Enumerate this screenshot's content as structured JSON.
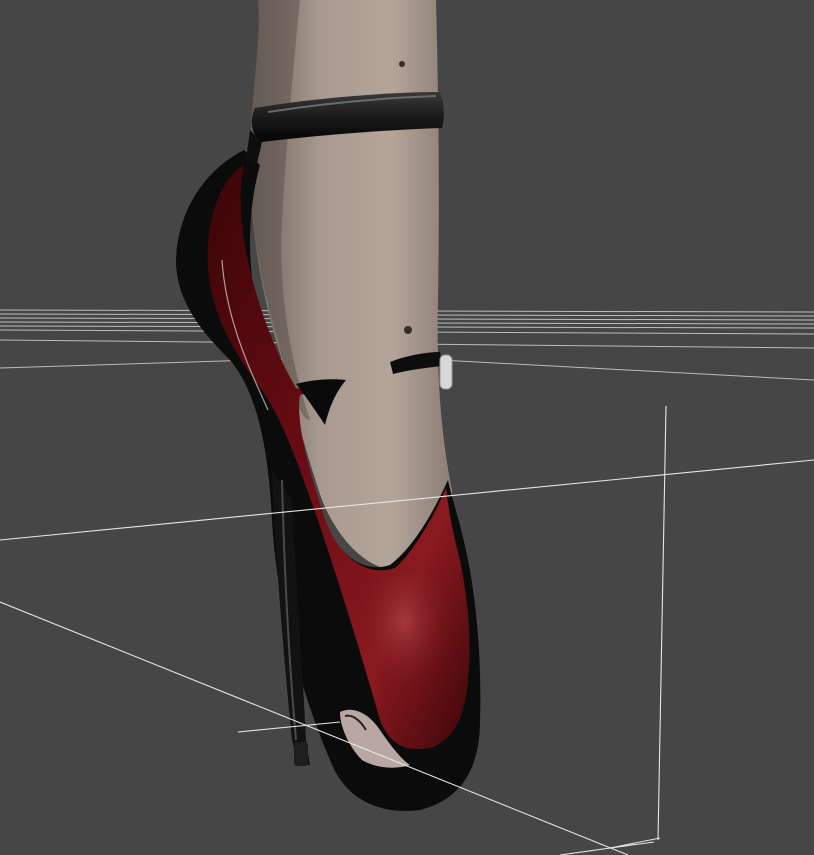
{
  "viewport": {
    "background_color": "#464646",
    "grid_color": "#e6e6e6"
  },
  "scene_object": {
    "shoe_main_color": "#5a0a10",
    "shoe_dark_color": "#0c0c0c",
    "strap_color": "#111111",
    "skin_color": "#a3948a"
  }
}
